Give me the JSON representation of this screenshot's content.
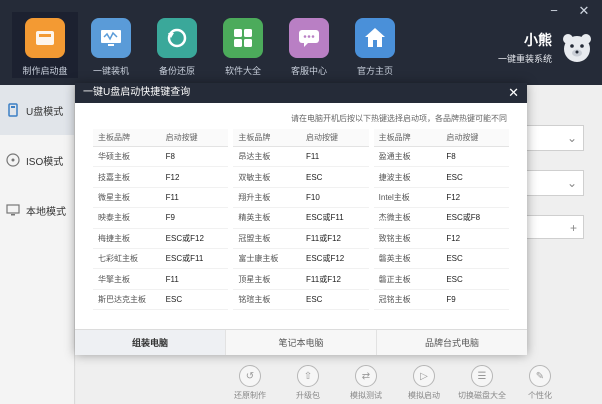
{
  "window": {
    "minimize_glyph": "−",
    "close_glyph": "✕"
  },
  "nav": {
    "items": [
      {
        "label": "制作启动盘",
        "icon": "usb-drive-icon",
        "color": "#f39a33",
        "active": true
      },
      {
        "label": "一键装机",
        "icon": "monitor-icon",
        "color": "#5a9bd8"
      },
      {
        "label": "备份还原",
        "icon": "restore-icon",
        "color": "#3aa89a"
      },
      {
        "label": "软件大全",
        "icon": "apps-grid-icon",
        "color": "#4cab5b"
      },
      {
        "label": "客服中心",
        "icon": "chat-icon",
        "color": "#b97fc4"
      },
      {
        "label": "官方主页",
        "icon": "home-icon",
        "color": "#4a90d9"
      }
    ]
  },
  "brand": {
    "name": "小熊",
    "subtitle": "一键重装系统"
  },
  "sidebar": {
    "items": [
      {
        "label": "U盘模式",
        "icon": "usb-icon"
      },
      {
        "label": "ISO模式",
        "icon": "disc-icon"
      },
      {
        "label": "本地模式",
        "icon": "computer-icon"
      }
    ]
  },
  "background": {
    "plus_glyph": "+",
    "bottom_items": [
      {
        "label": "还原制作",
        "glyph": "↺"
      },
      {
        "label": "升级包",
        "glyph": "⇧"
      },
      {
        "label": "模拟测试",
        "glyph": "⇄"
      },
      {
        "label": "模拟启动",
        "glyph": "▷"
      },
      {
        "label": "切换磁盘大全",
        "glyph": "☰"
      },
      {
        "label": "个性化",
        "glyph": "✎"
      }
    ]
  },
  "dialog": {
    "title": "一键U盘启动快捷键查询",
    "hint": "请在电脑开机后按以下热键选择启动项，各品牌热键可能不同",
    "header_brand": "主板品牌",
    "header_key": "启动按键",
    "columns": [
      [
        {
          "brand": "华硕主板",
          "key": "F8"
        },
        {
          "brand": "技嘉主板",
          "key": "F12"
        },
        {
          "brand": "微星主板",
          "key": "F11"
        },
        {
          "brand": "映泰主板",
          "key": "F9"
        },
        {
          "brand": "梅捷主板",
          "key": "ESC或F12"
        },
        {
          "brand": "七彩虹主板",
          "key": "ESC或F11"
        },
        {
          "brand": "华擎主板",
          "key": "F11"
        },
        {
          "brand": "斯巴达克主板",
          "key": "ESC"
        }
      ],
      [
        {
          "brand": "昂达主板",
          "key": "F11"
        },
        {
          "brand": "双敏主板",
          "key": "ESC"
        },
        {
          "brand": "翔升主板",
          "key": "F10"
        },
        {
          "brand": "精英主板",
          "key": "ESC或F11"
        },
        {
          "brand": "冠盟主板",
          "key": "F11或F12"
        },
        {
          "brand": "富士康主板",
          "key": "ESC或F12"
        },
        {
          "brand": "顶星主板",
          "key": "F11或F12"
        },
        {
          "brand": "铭瑄主板",
          "key": "ESC"
        }
      ],
      [
        {
          "brand": "盈通主板",
          "key": "F8"
        },
        {
          "brand": "捷波主板",
          "key": "ESC"
        },
        {
          "brand": "Intel主板",
          "key": "F12"
        },
        {
          "brand": "杰微主板",
          "key": "ESC或F8"
        },
        {
          "brand": "致铭主板",
          "key": "F12"
        },
        {
          "brand": "磐英主板",
          "key": "ESC"
        },
        {
          "brand": "磐正主板",
          "key": "ESC"
        },
        {
          "brand": "冠铭主板",
          "key": "F9"
        }
      ]
    ],
    "tabs": [
      {
        "label": "组装电脑",
        "active": true
      },
      {
        "label": "笔记本电脑"
      },
      {
        "label": "品牌台式电脑"
      }
    ],
    "close_glyph": "✕"
  }
}
